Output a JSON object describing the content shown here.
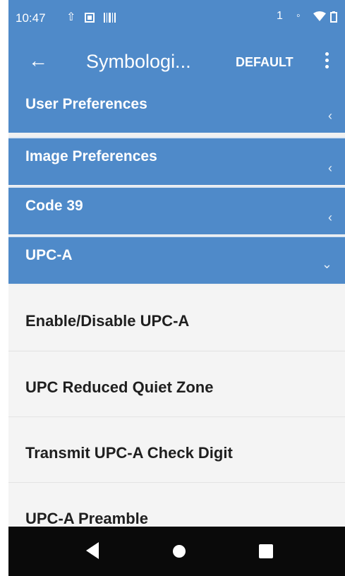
{
  "status_bar": {
    "time": "10:47",
    "left_icons": [
      "upload-icon",
      "image-icon",
      "barcode-icon"
    ],
    "right_icons": [
      "signal-icon",
      "vibrate-icon",
      "wifi-icon",
      "battery-icon"
    ]
  },
  "app_bar": {
    "title": "Symbologi...",
    "default_label": "DEFAULT"
  },
  "groups": [
    {
      "label": "User Preferences",
      "state": "collapsed"
    },
    {
      "label": "Image Preferences",
      "state": "collapsed"
    },
    {
      "label": "Code 39",
      "state": "collapsed"
    },
    {
      "label": "UPC-A",
      "state": "expanded"
    }
  ],
  "items": [
    {
      "label": "Enable/Disable UPC-A"
    },
    {
      "label": "UPC Reduced Quiet Zone"
    },
    {
      "label": "Transmit UPC-A Check Digit"
    },
    {
      "label": "UPC-A Preamble"
    }
  ],
  "colors": {
    "accent": "#4f8ac9",
    "list_background": "#f4f4f4",
    "nav_bar": "#0a0a0a"
  }
}
